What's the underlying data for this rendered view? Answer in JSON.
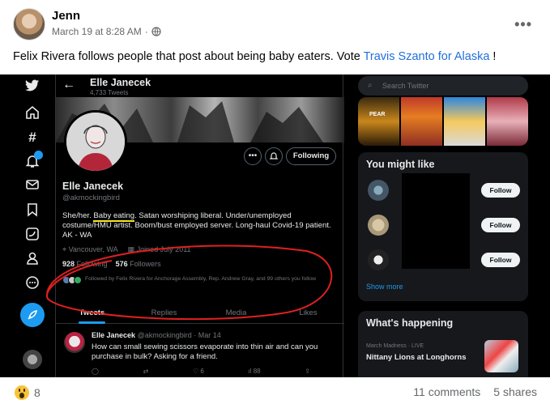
{
  "post": {
    "author": "Jenn",
    "date": "March 19 at 8:28 AM",
    "separator": "·",
    "more": "•••",
    "text_before": "Felix Rivera follows people that post about being baby eaters. Vote ",
    "link": "Travis Szanto for Alaska",
    "text_after": " !"
  },
  "twitter": {
    "topbar": {
      "name": "Elle Janecek",
      "tweet_count": "4,733 Tweets"
    },
    "profile": {
      "name": "Elle Janecek",
      "handle": "@akmockingbird",
      "bio_1": "She/her. ",
      "bio_hl": "Baby eating",
      "bio_2": ". Satan worshiping liberal. Under/unemployed costume/HMU artist. Boom/bust employed server. Long-haul Covid-19 patient. AK - WA",
      "location": "Vancouver, WA",
      "joined": "Joined July 2011",
      "following_count": "928",
      "following_label": "Following",
      "followers_count": "576",
      "followers_label": "Followers",
      "followed_by": "Followed by Felix Rivera for Anchorage Assembly, Rep. Andrew Gray, and 99 others you follow",
      "follow_button": "Following",
      "more_button": "•••"
    },
    "tabs": [
      "Tweets",
      "Replies",
      "Media",
      "Likes"
    ],
    "tweet": {
      "name": "Elle Janecek",
      "meta": "@akmockingbird · Mar 14",
      "text": "How can small sewing scissors evaporate into thin air and can you purchase in bulk? Asking for a friend.",
      "likes": "6",
      "views": "88"
    },
    "search_placeholder": "Search Twitter",
    "media_text": "PEAR",
    "you_might_like": {
      "title": "You might like",
      "follow_label": "Follow",
      "show_more": "Show more"
    },
    "whats_happening": {
      "title": "What's happening",
      "category": "March Madness · LIVE",
      "headline": "Nittany Lions at Longhorns"
    }
  },
  "footer": {
    "reaction_count": "8",
    "comments": "11 comments",
    "shares": "5 shares"
  },
  "colors": {
    "facebook_link": "#216fdb",
    "twitter_blue": "#1d9bf0",
    "highlight_yellow": "#f5e61c",
    "annotation_red": "#e02020"
  }
}
